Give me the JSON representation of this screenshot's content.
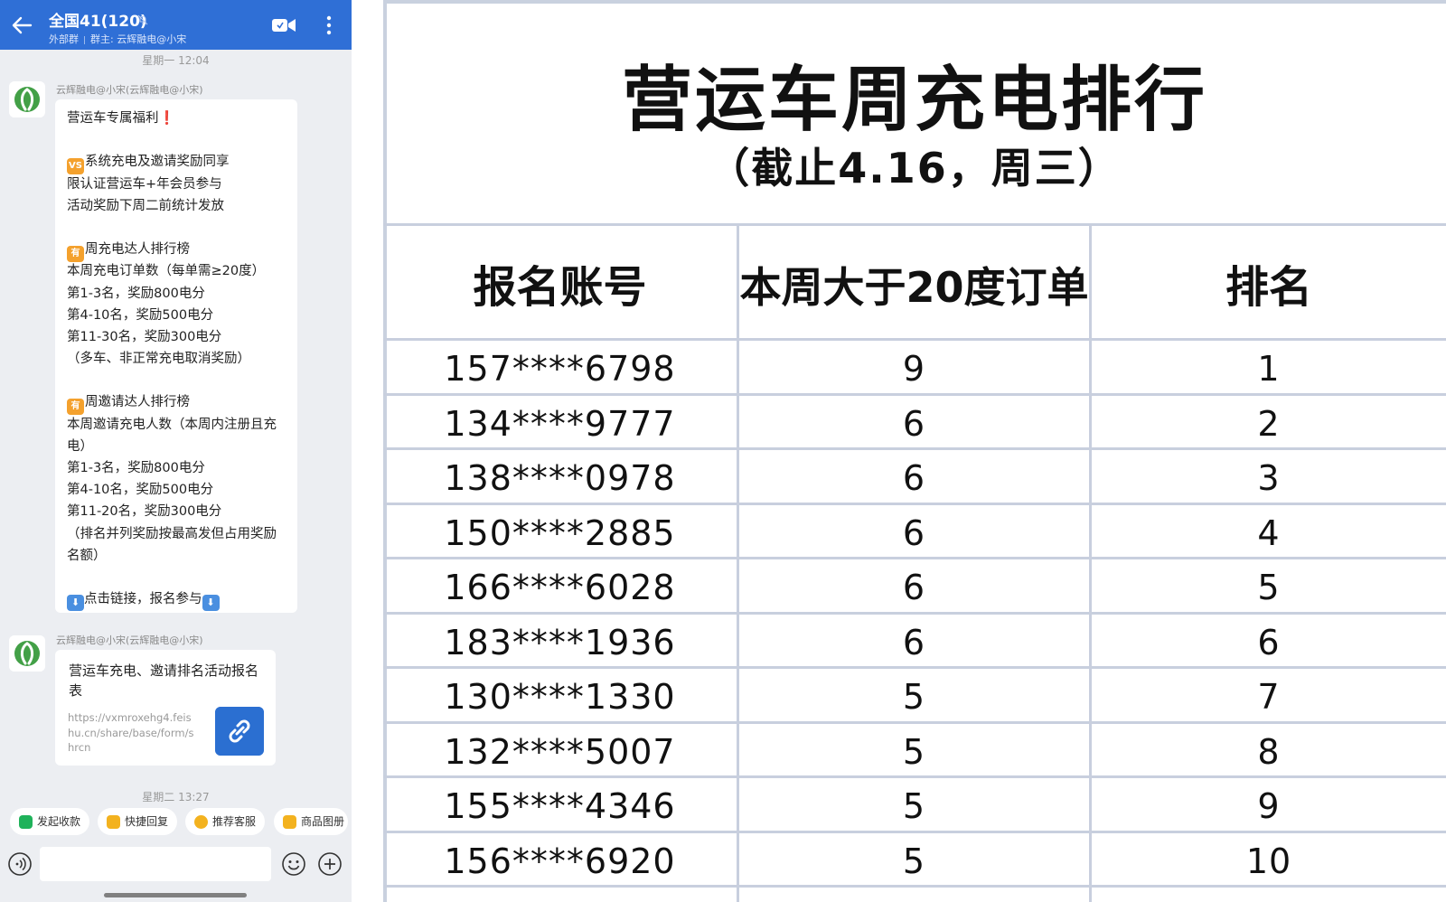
{
  "chat": {
    "header": {
      "title": "全国41(120)",
      "subtitle_left": "外部群",
      "subtitle_right": "群主: 云辉融电@小宋"
    },
    "timestamp_1": "星期一  12:04",
    "message_1": {
      "sender": "云辉融电@小宋(云辉融电@小宋)",
      "lines": [
        "营运车专属福利",
        "",
        "系统充电及邀请奖励同享",
        "限认证营运车+年会员参与",
        "活动奖励下周二前统计发放",
        "",
        "周充电达人排行榜",
        "本周充电订单数（每单需≥20度）",
        "第1-3名，奖励800电分",
        "第4-10名，奖励500电分",
        "第11-30名，奖励300电分",
        "（多车、非正常充电取消奖励）",
        "",
        "周邀请达人排行榜",
        "本周邀请充电人数（本周内注册且充电）",
        "第1-3名，奖励800电分",
        "第4-10名，奖励500电分",
        "第11-20名，奖励300电分",
        "（排名并列奖励按最高发但占用奖励名额）",
        "",
        "点击链接，报名参与"
      ],
      "tag_vs": "VS",
      "tag_you": "有",
      "tag_down": "⬇"
    },
    "message_2": {
      "sender": "云辉融电@小宋(云辉融电@小宋)",
      "card_title": "营运车充电、邀请排名活动报名表",
      "card_url": "https://vxmroxehg4.feishu.cn/share/base/form/shrcn"
    },
    "timestamp_2": "星期二  13:27",
    "quick_actions": [
      "发起收款",
      "快捷回复",
      "推荐客服",
      "商品图册"
    ],
    "input": {
      "value": "",
      "placeholder": ""
    },
    "colors": {
      "header": "#2f6fd6",
      "link_button": "#2b6fd1",
      "tag_orange": "#f4a12d"
    }
  },
  "ranking": {
    "title": "营运车周充电排行",
    "subtitle": "（截止4.16，周三）",
    "columns": [
      "报名账号",
      "本周大于20度订单",
      "排名"
    ],
    "rows": [
      {
        "account": "157****6798",
        "orders": "9",
        "rank": "1"
      },
      {
        "account": "134****9777",
        "orders": "6",
        "rank": "2"
      },
      {
        "account": "138****0978",
        "orders": "6",
        "rank": "3"
      },
      {
        "account": "150****2885",
        "orders": "6",
        "rank": "4"
      },
      {
        "account": "166****6028",
        "orders": "6",
        "rank": "5"
      },
      {
        "account": "183****1936",
        "orders": "6",
        "rank": "6"
      },
      {
        "account": "130****1330",
        "orders": "5",
        "rank": "7"
      },
      {
        "account": "132****5007",
        "orders": "5",
        "rank": "8"
      },
      {
        "account": "155****4346",
        "orders": "5",
        "rank": "9"
      },
      {
        "account": "156****6920",
        "orders": "5",
        "rank": "10"
      }
    ]
  }
}
